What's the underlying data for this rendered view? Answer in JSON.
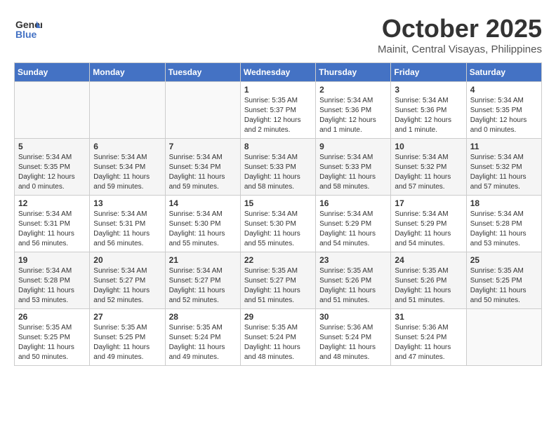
{
  "header": {
    "logo_general": "General",
    "logo_blue": "Blue",
    "month_title": "October 2025",
    "location": "Mainit, Central Visayas, Philippines"
  },
  "days_of_week": [
    "Sunday",
    "Monday",
    "Tuesday",
    "Wednesday",
    "Thursday",
    "Friday",
    "Saturday"
  ],
  "weeks": [
    [
      {
        "day": "",
        "info": ""
      },
      {
        "day": "",
        "info": ""
      },
      {
        "day": "",
        "info": ""
      },
      {
        "day": "1",
        "info": "Sunrise: 5:35 AM\nSunset: 5:37 PM\nDaylight: 12 hours\nand 2 minutes."
      },
      {
        "day": "2",
        "info": "Sunrise: 5:34 AM\nSunset: 5:36 PM\nDaylight: 12 hours\nand 1 minute."
      },
      {
        "day": "3",
        "info": "Sunrise: 5:34 AM\nSunset: 5:36 PM\nDaylight: 12 hours\nand 1 minute."
      },
      {
        "day": "4",
        "info": "Sunrise: 5:34 AM\nSunset: 5:35 PM\nDaylight: 12 hours\nand 0 minutes."
      }
    ],
    [
      {
        "day": "5",
        "info": "Sunrise: 5:34 AM\nSunset: 5:35 PM\nDaylight: 12 hours\nand 0 minutes."
      },
      {
        "day": "6",
        "info": "Sunrise: 5:34 AM\nSunset: 5:34 PM\nDaylight: 11 hours\nand 59 minutes."
      },
      {
        "day": "7",
        "info": "Sunrise: 5:34 AM\nSunset: 5:34 PM\nDaylight: 11 hours\nand 59 minutes."
      },
      {
        "day": "8",
        "info": "Sunrise: 5:34 AM\nSunset: 5:33 PM\nDaylight: 11 hours\nand 58 minutes."
      },
      {
        "day": "9",
        "info": "Sunrise: 5:34 AM\nSunset: 5:33 PM\nDaylight: 11 hours\nand 58 minutes."
      },
      {
        "day": "10",
        "info": "Sunrise: 5:34 AM\nSunset: 5:32 PM\nDaylight: 11 hours\nand 57 minutes."
      },
      {
        "day": "11",
        "info": "Sunrise: 5:34 AM\nSunset: 5:32 PM\nDaylight: 11 hours\nand 57 minutes."
      }
    ],
    [
      {
        "day": "12",
        "info": "Sunrise: 5:34 AM\nSunset: 5:31 PM\nDaylight: 11 hours\nand 56 minutes."
      },
      {
        "day": "13",
        "info": "Sunrise: 5:34 AM\nSunset: 5:31 PM\nDaylight: 11 hours\nand 56 minutes."
      },
      {
        "day": "14",
        "info": "Sunrise: 5:34 AM\nSunset: 5:30 PM\nDaylight: 11 hours\nand 55 minutes."
      },
      {
        "day": "15",
        "info": "Sunrise: 5:34 AM\nSunset: 5:30 PM\nDaylight: 11 hours\nand 55 minutes."
      },
      {
        "day": "16",
        "info": "Sunrise: 5:34 AM\nSunset: 5:29 PM\nDaylight: 11 hours\nand 54 minutes."
      },
      {
        "day": "17",
        "info": "Sunrise: 5:34 AM\nSunset: 5:29 PM\nDaylight: 11 hours\nand 54 minutes."
      },
      {
        "day": "18",
        "info": "Sunrise: 5:34 AM\nSunset: 5:28 PM\nDaylight: 11 hours\nand 53 minutes."
      }
    ],
    [
      {
        "day": "19",
        "info": "Sunrise: 5:34 AM\nSunset: 5:28 PM\nDaylight: 11 hours\nand 53 minutes."
      },
      {
        "day": "20",
        "info": "Sunrise: 5:34 AM\nSunset: 5:27 PM\nDaylight: 11 hours\nand 52 minutes."
      },
      {
        "day": "21",
        "info": "Sunrise: 5:34 AM\nSunset: 5:27 PM\nDaylight: 11 hours\nand 52 minutes."
      },
      {
        "day": "22",
        "info": "Sunrise: 5:35 AM\nSunset: 5:27 PM\nDaylight: 11 hours\nand 51 minutes."
      },
      {
        "day": "23",
        "info": "Sunrise: 5:35 AM\nSunset: 5:26 PM\nDaylight: 11 hours\nand 51 minutes."
      },
      {
        "day": "24",
        "info": "Sunrise: 5:35 AM\nSunset: 5:26 PM\nDaylight: 11 hours\nand 51 minutes."
      },
      {
        "day": "25",
        "info": "Sunrise: 5:35 AM\nSunset: 5:25 PM\nDaylight: 11 hours\nand 50 minutes."
      }
    ],
    [
      {
        "day": "26",
        "info": "Sunrise: 5:35 AM\nSunset: 5:25 PM\nDaylight: 11 hours\nand 50 minutes."
      },
      {
        "day": "27",
        "info": "Sunrise: 5:35 AM\nSunset: 5:25 PM\nDaylight: 11 hours\nand 49 minutes."
      },
      {
        "day": "28",
        "info": "Sunrise: 5:35 AM\nSunset: 5:24 PM\nDaylight: 11 hours\nand 49 minutes."
      },
      {
        "day": "29",
        "info": "Sunrise: 5:35 AM\nSunset: 5:24 PM\nDaylight: 11 hours\nand 48 minutes."
      },
      {
        "day": "30",
        "info": "Sunrise: 5:36 AM\nSunset: 5:24 PM\nDaylight: 11 hours\nand 48 minutes."
      },
      {
        "day": "31",
        "info": "Sunrise: 5:36 AM\nSunset: 5:24 PM\nDaylight: 11 hours\nand 47 minutes."
      },
      {
        "day": "",
        "info": ""
      }
    ]
  ]
}
